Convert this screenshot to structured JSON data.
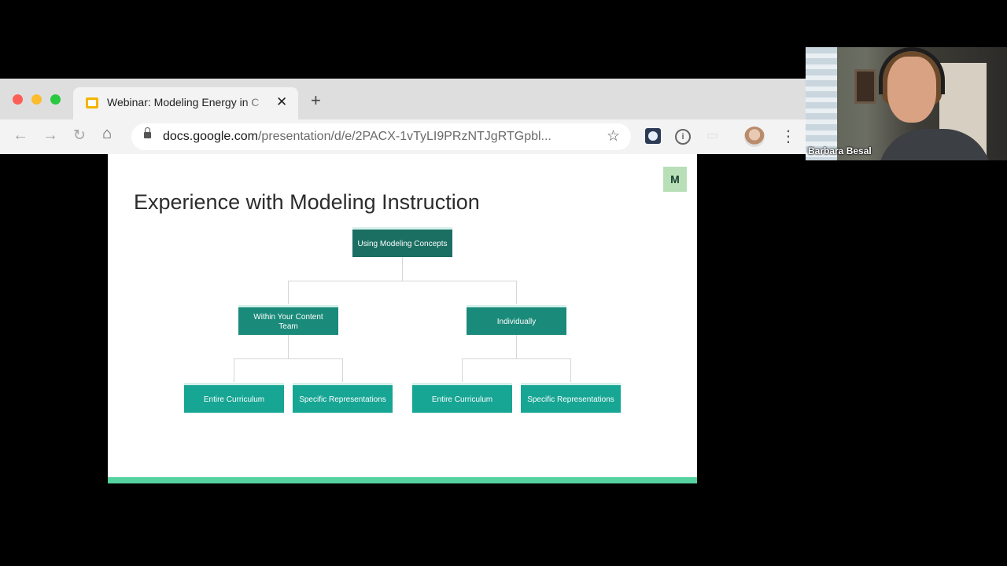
{
  "browser": {
    "tab": {
      "title": "Webinar: Modeling Energy in C"
    },
    "url": {
      "host": "docs.google.com",
      "path": "/presentation/d/e/2PACX-1vTyLI9PRzNTJgRTGpbl..."
    }
  },
  "slide": {
    "logo": "M",
    "title": "Experience with Modeling Instruction",
    "accent_color": "#56d1a0",
    "nodes": {
      "root": "Using Modeling Concepts",
      "left": "Within Your Content Team",
      "right": "Individually",
      "left_a": "Entire Curriculum",
      "left_b": "Specific Representations",
      "right_a": "Entire Curriculum",
      "right_b": "Specific Representations"
    },
    "colors": {
      "dark": "#1b6e62",
      "mid": "#1a8a7a",
      "light": "#17a594"
    }
  },
  "webcam": {
    "participant_name": "Barbara Besal"
  }
}
